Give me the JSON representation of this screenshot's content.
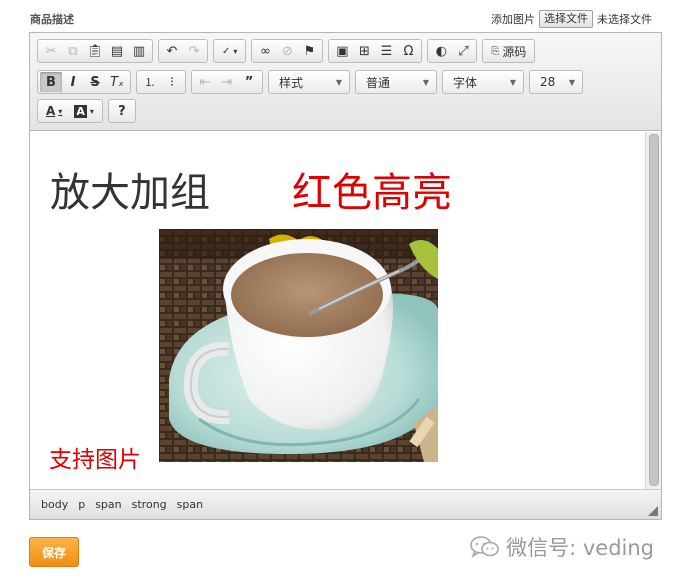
{
  "form": {
    "field_label": "商品描述",
    "upload_label": "添加图片",
    "choose_file_button": "选择文件",
    "no_file_text": "未选择文件",
    "save_button": "保存"
  },
  "toolbar": {
    "format_combo": "样式",
    "paragraph_combo": "普通",
    "font_combo": "字体",
    "size_combo": "28",
    "source_label": "源码"
  },
  "content": {
    "large_text": "放大加组",
    "highlight_text": "红色高亮",
    "image_caption": "支持图片",
    "highlight_color": "#e00000"
  },
  "statusbar": {
    "path": [
      "body",
      "p",
      "span",
      "strong",
      "span"
    ]
  },
  "watermark": {
    "text": "微信号: veding"
  },
  "icons": [
    "cut-icon",
    "copy-icon",
    "paste-icon",
    "paste-text-icon",
    "paste-word-icon",
    "undo-icon",
    "redo-icon",
    "spellcheck-icon",
    "link-icon",
    "unlink-icon",
    "anchor-icon",
    "image-icon",
    "table-icon",
    "horizontal-line-icon",
    "special-char-icon",
    "preview-icon",
    "maximize-icon",
    "source-icon",
    "bold-icon",
    "italic-icon",
    "strike-icon",
    "remove-format-icon",
    "numbered-list-icon",
    "bullet-list-icon",
    "outdent-icon",
    "indent-icon",
    "blockquote-icon",
    "text-color-icon",
    "bg-color-icon",
    "help-icon"
  ]
}
